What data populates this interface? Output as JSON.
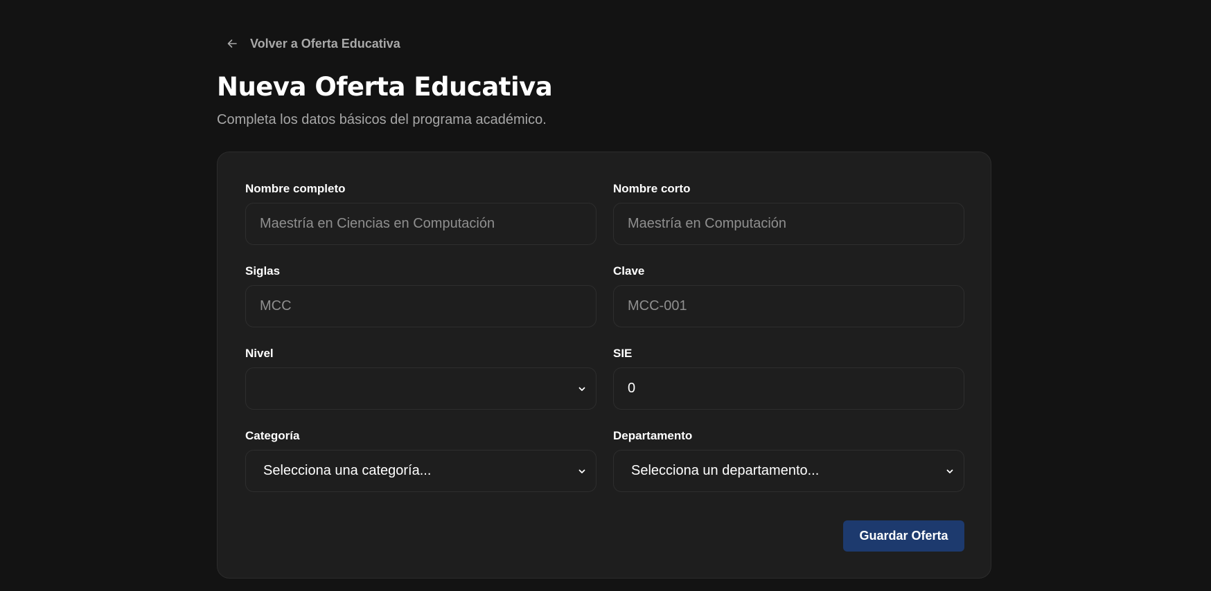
{
  "back": {
    "label": "Volver a Oferta Educativa",
    "icon": "arrow-left-icon"
  },
  "header": {
    "title": "Nueva Oferta Educativa",
    "subtitle": "Completa los datos básicos del programa académico."
  },
  "form": {
    "nombre_completo": {
      "label": "Nombre completo",
      "placeholder": "Maestría en Ciencias en Computación",
      "value": ""
    },
    "nombre_corto": {
      "label": "Nombre corto",
      "placeholder": "Maestría en Computación",
      "value": ""
    },
    "siglas": {
      "label": "Siglas",
      "placeholder": "MCC",
      "value": ""
    },
    "clave": {
      "label": "Clave",
      "placeholder": "MCC-001",
      "value": ""
    },
    "nivel": {
      "label": "Nivel",
      "selected": ""
    },
    "sie": {
      "label": "SIE",
      "value": "0"
    },
    "categoria": {
      "label": "Categoría",
      "selected": "Selecciona una categoría..."
    },
    "departamento": {
      "label": "Departamento",
      "selected": "Selecciona un departamento..."
    }
  },
  "actions": {
    "save_label": "Guardar Oferta"
  },
  "colors": {
    "background": "#131313",
    "card": "#1e1e1e",
    "primary_button": "#1d3a6e",
    "muted_text": "#a7a7a7"
  }
}
